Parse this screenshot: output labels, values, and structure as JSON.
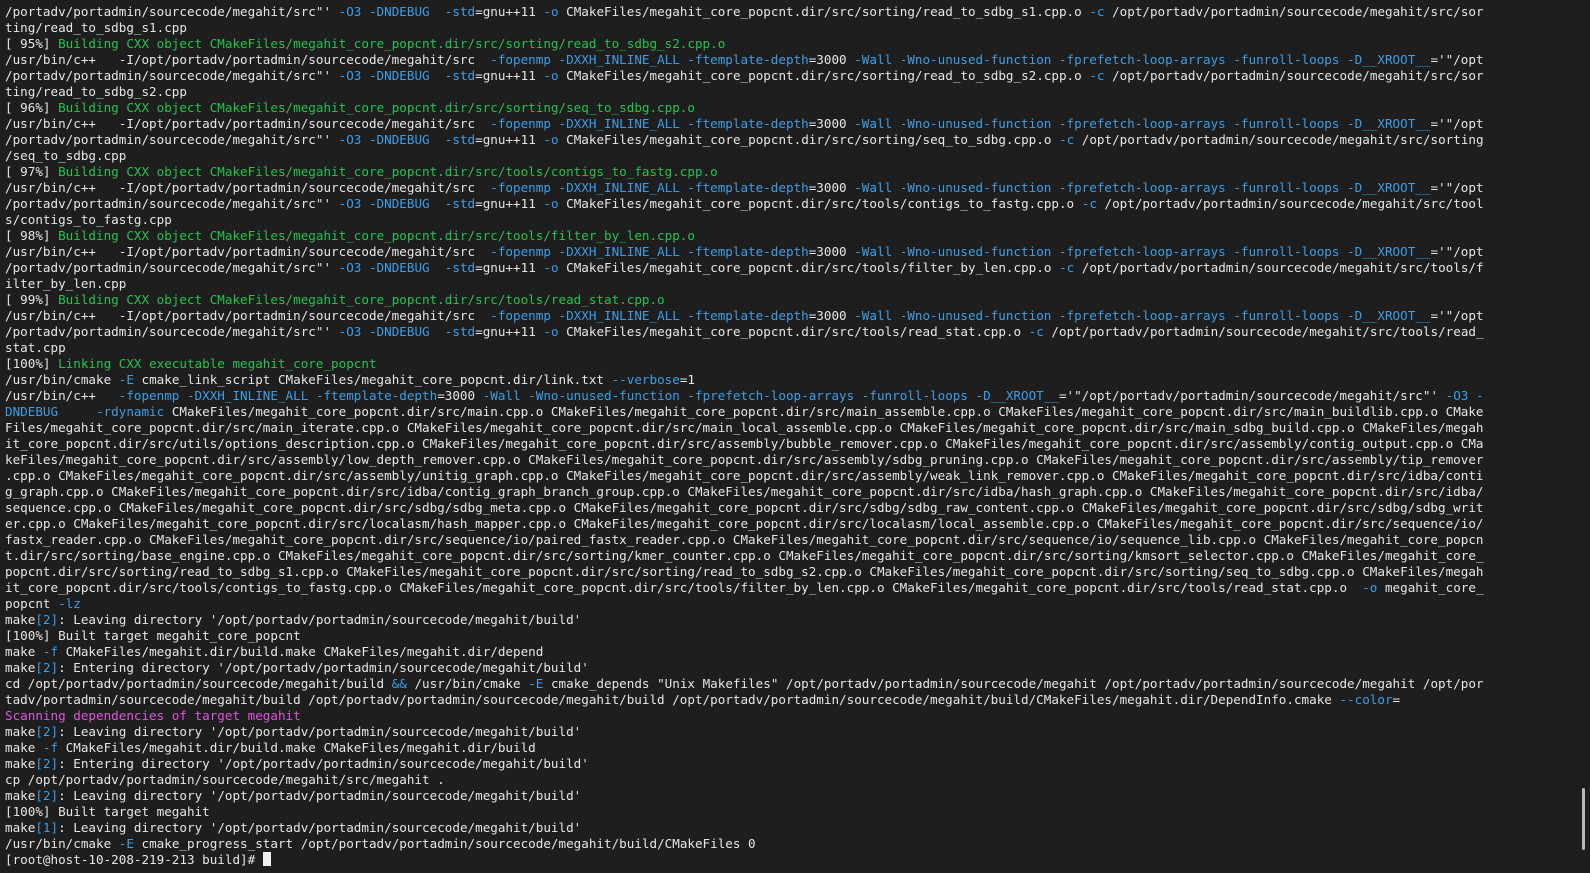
{
  "colors": {
    "background": "#1e1e1e",
    "text": "#e6e6e6",
    "flag": "#3a9ee8",
    "progress_green": "#21c44f",
    "magenta": "#e052e0"
  },
  "terminal": {
    "lines": [
      [
        [
          "/portadv/portadmin/sourcecode/megahit/src\"' ",
          "t"
        ],
        [
          "-O3 -DNDEBUG",
          "f"
        ],
        [
          "  ",
          "t"
        ],
        [
          "-std",
          "f"
        ],
        [
          "=gnu++11 ",
          "t"
        ],
        [
          "-o",
          "f"
        ],
        [
          " CMakeFiles/megahit_core_popcnt.dir/src/sorting/read_to_sdbg_s1.cpp.o ",
          "t"
        ],
        [
          "-c",
          "f"
        ],
        [
          " /opt/portadv/portadmin/sourcecode/megahit/src/sor",
          "t"
        ]
      ],
      [
        [
          "ting/read_to_sdbg_s1.cpp",
          "t"
        ]
      ],
      [
        [
          "[ 95%] ",
          "t"
        ],
        [
          "Building CXX object CMakeFiles/megahit_core_popcnt.dir/src/sorting/read_to_sdbg_s2.cpp.o",
          "g"
        ]
      ],
      [
        [
          "/usr/bin/c++   -I/opt/portadv/portadmin/sourcecode/megahit/src  ",
          "t"
        ],
        [
          "-fopenmp -DXXH_INLINE_ALL -ftemplate-depth",
          "f"
        ],
        [
          "=3000 ",
          "t"
        ],
        [
          "-Wall -Wno-unused-function -fprefetch-loop-arrays -funroll-loops -D__XROOT__",
          "f"
        ],
        [
          "='\"/opt",
          "t"
        ]
      ],
      [
        [
          "/portadv/portadmin/sourcecode/megahit/src\"' ",
          "t"
        ],
        [
          "-O3 -DNDEBUG",
          "f"
        ],
        [
          "  ",
          "t"
        ],
        [
          "-std",
          "f"
        ],
        [
          "=gnu++11 ",
          "t"
        ],
        [
          "-o",
          "f"
        ],
        [
          " CMakeFiles/megahit_core_popcnt.dir/src/sorting/read_to_sdbg_s2.cpp.o ",
          "t"
        ],
        [
          "-c",
          "f"
        ],
        [
          " /opt/portadv/portadmin/sourcecode/megahit/src/sor",
          "t"
        ]
      ],
      [
        [
          "ting/read_to_sdbg_s2.cpp",
          "t"
        ]
      ],
      [
        [
          "[ 96%] ",
          "t"
        ],
        [
          "Building CXX object CMakeFiles/megahit_core_popcnt.dir/src/sorting/seq_to_sdbg.cpp.o",
          "g"
        ]
      ],
      [
        [
          "/usr/bin/c++   -I/opt/portadv/portadmin/sourcecode/megahit/src  ",
          "t"
        ],
        [
          "-fopenmp -DXXH_INLINE_ALL -ftemplate-depth",
          "f"
        ],
        [
          "=3000 ",
          "t"
        ],
        [
          "-Wall -Wno-unused-function -fprefetch-loop-arrays -funroll-loops -D__XROOT__",
          "f"
        ],
        [
          "='\"/opt",
          "t"
        ]
      ],
      [
        [
          "/portadv/portadmin/sourcecode/megahit/src\"' ",
          "t"
        ],
        [
          "-O3 -DNDEBUG",
          "f"
        ],
        [
          "  ",
          "t"
        ],
        [
          "-std",
          "f"
        ],
        [
          "=gnu++11 ",
          "t"
        ],
        [
          "-o",
          "f"
        ],
        [
          " CMakeFiles/megahit_core_popcnt.dir/src/sorting/seq_to_sdbg.cpp.o ",
          "t"
        ],
        [
          "-c",
          "f"
        ],
        [
          " /opt/portadv/portadmin/sourcecode/megahit/src/sorting",
          "t"
        ]
      ],
      [
        [
          "/seq_to_sdbg.cpp",
          "t"
        ]
      ],
      [
        [
          "[ 97%] ",
          "t"
        ],
        [
          "Building CXX object CMakeFiles/megahit_core_popcnt.dir/src/tools/contigs_to_fastg.cpp.o",
          "g"
        ]
      ],
      [
        [
          "/usr/bin/c++   -I/opt/portadv/portadmin/sourcecode/megahit/src  ",
          "t"
        ],
        [
          "-fopenmp -DXXH_INLINE_ALL -ftemplate-depth",
          "f"
        ],
        [
          "=3000 ",
          "t"
        ],
        [
          "-Wall -Wno-unused-function -fprefetch-loop-arrays -funroll-loops -D__XROOT__",
          "f"
        ],
        [
          "='\"/opt",
          "t"
        ]
      ],
      [
        [
          "/portadv/portadmin/sourcecode/megahit/src\"' ",
          "t"
        ],
        [
          "-O3 -DNDEBUG",
          "f"
        ],
        [
          "  ",
          "t"
        ],
        [
          "-std",
          "f"
        ],
        [
          "=gnu++11 ",
          "t"
        ],
        [
          "-o",
          "f"
        ],
        [
          " CMakeFiles/megahit_core_popcnt.dir/src/tools/contigs_to_fastg.cpp.o ",
          "t"
        ],
        [
          "-c",
          "f"
        ],
        [
          " /opt/portadv/portadmin/sourcecode/megahit/src/tool",
          "t"
        ]
      ],
      [
        [
          "s/contigs_to_fastg.cpp",
          "t"
        ]
      ],
      [
        [
          "[ 98%] ",
          "t"
        ],
        [
          "Building CXX object CMakeFiles/megahit_core_popcnt.dir/src/tools/filter_by_len.cpp.o",
          "g"
        ]
      ],
      [
        [
          "/usr/bin/c++   -I/opt/portadv/portadmin/sourcecode/megahit/src  ",
          "t"
        ],
        [
          "-fopenmp -DXXH_INLINE_ALL -ftemplate-depth",
          "f"
        ],
        [
          "=3000 ",
          "t"
        ],
        [
          "-Wall -Wno-unused-function -fprefetch-loop-arrays -funroll-loops -D__XROOT__",
          "f"
        ],
        [
          "='\"/opt",
          "t"
        ]
      ],
      [
        [
          "/portadv/portadmin/sourcecode/megahit/src\"' ",
          "t"
        ],
        [
          "-O3 -DNDEBUG",
          "f"
        ],
        [
          "  ",
          "t"
        ],
        [
          "-std",
          "f"
        ],
        [
          "=gnu++11 ",
          "t"
        ],
        [
          "-o",
          "f"
        ],
        [
          " CMakeFiles/megahit_core_popcnt.dir/src/tools/filter_by_len.cpp.o ",
          "t"
        ],
        [
          "-c",
          "f"
        ],
        [
          " /opt/portadv/portadmin/sourcecode/megahit/src/tools/f",
          "t"
        ]
      ],
      [
        [
          "ilter_by_len.cpp",
          "t"
        ]
      ],
      [
        [
          "[ 99%] ",
          "t"
        ],
        [
          "Building CXX object CMakeFiles/megahit_core_popcnt.dir/src/tools/read_stat.cpp.o",
          "g"
        ]
      ],
      [
        [
          "/usr/bin/c++   -I/opt/portadv/portadmin/sourcecode/megahit/src  ",
          "t"
        ],
        [
          "-fopenmp -DXXH_INLINE_ALL -ftemplate-depth",
          "f"
        ],
        [
          "=3000 ",
          "t"
        ],
        [
          "-Wall -Wno-unused-function -fprefetch-loop-arrays -funroll-loops -D__XROOT__",
          "f"
        ],
        [
          "='\"/opt",
          "t"
        ]
      ],
      [
        [
          "/portadv/portadmin/sourcecode/megahit/src\"' ",
          "t"
        ],
        [
          "-O3 -DNDEBUG",
          "f"
        ],
        [
          "  ",
          "t"
        ],
        [
          "-std",
          "f"
        ],
        [
          "=gnu++11 ",
          "t"
        ],
        [
          "-o",
          "f"
        ],
        [
          " CMakeFiles/megahit_core_popcnt.dir/src/tools/read_stat.cpp.o ",
          "t"
        ],
        [
          "-c",
          "f"
        ],
        [
          " /opt/portadv/portadmin/sourcecode/megahit/src/tools/read_",
          "t"
        ]
      ],
      [
        [
          "stat.cpp",
          "t"
        ]
      ],
      [
        [
          "[100%] ",
          "t"
        ],
        [
          "Linking CXX executable megahit_core_popcnt",
          "g"
        ]
      ],
      [
        [
          "/usr/bin/cmake ",
          "t"
        ],
        [
          "-E",
          "f"
        ],
        [
          " cmake_link_script CMakeFiles/megahit_core_popcnt.dir/link.txt ",
          "t"
        ],
        [
          "--verbose",
          "f"
        ],
        [
          "=1",
          "t"
        ]
      ],
      [
        [
          "/usr/bin/c++   ",
          "t"
        ],
        [
          "-fopenmp -DXXH_INLINE_ALL -ftemplate-depth",
          "f"
        ],
        [
          "=3000 ",
          "t"
        ],
        [
          "-Wall -Wno-unused-function -fprefetch-loop-arrays -funroll-loops -D__XROOT__",
          "f"
        ],
        [
          "='\"/opt/portadv/portadmin/sourcecode/megahit/src\"' ",
          "t"
        ],
        [
          "-O3 -",
          "f"
        ]
      ],
      [
        [
          "DNDEBUG     -rdynamic",
          "f"
        ],
        [
          " CMakeFiles/megahit_core_popcnt.dir/src/main.cpp.o CMakeFiles/megahit_core_popcnt.dir/src/main_assemble.cpp.o CMakeFiles/megahit_core_popcnt.dir/src/main_buildlib.cpp.o CMake",
          "t"
        ]
      ],
      [
        [
          "Files/megahit_core_popcnt.dir/src/main_iterate.cpp.o CMakeFiles/megahit_core_popcnt.dir/src/main_local_assemble.cpp.o CMakeFiles/megahit_core_popcnt.dir/src/main_sdbg_build.cpp.o CMakeFiles/megah",
          "t"
        ]
      ],
      [
        [
          "it_core_popcnt.dir/src/utils/options_description.cpp.o CMakeFiles/megahit_core_popcnt.dir/src/assembly/bubble_remover.cpp.o CMakeFiles/megahit_core_popcnt.dir/src/assembly/contig_output.cpp.o CMa",
          "t"
        ]
      ],
      [
        [
          "keFiles/megahit_core_popcnt.dir/src/assembly/low_depth_remover.cpp.o CMakeFiles/megahit_core_popcnt.dir/src/assembly/sdbg_pruning.cpp.o CMakeFiles/megahit_core_popcnt.dir/src/assembly/tip_remover",
          "t"
        ]
      ],
      [
        [
          ".cpp.o CMakeFiles/megahit_core_popcnt.dir/src/assembly/unitig_graph.cpp.o CMakeFiles/megahit_core_popcnt.dir/src/assembly/weak_link_remover.cpp.o CMakeFiles/megahit_core_popcnt.dir/src/idba/conti",
          "t"
        ]
      ],
      [
        [
          "g_graph.cpp.o CMakeFiles/megahit_core_popcnt.dir/src/idba/contig_graph_branch_group.cpp.o CMakeFiles/megahit_core_popcnt.dir/src/idba/hash_graph.cpp.o CMakeFiles/megahit_core_popcnt.dir/src/idba/",
          "t"
        ]
      ],
      [
        [
          "sequence.cpp.o CMakeFiles/megahit_core_popcnt.dir/src/sdbg/sdbg_meta.cpp.o CMakeFiles/megahit_core_popcnt.dir/src/sdbg/sdbg_raw_content.cpp.o CMakeFiles/megahit_core_popcnt.dir/src/sdbg/sdbg_writ",
          "t"
        ]
      ],
      [
        [
          "er.cpp.o CMakeFiles/megahit_core_popcnt.dir/src/localasm/hash_mapper.cpp.o CMakeFiles/megahit_core_popcnt.dir/src/localasm/local_assemble.cpp.o CMakeFiles/megahit_core_popcnt.dir/src/sequence/io/",
          "t"
        ]
      ],
      [
        [
          "fastx_reader.cpp.o CMakeFiles/megahit_core_popcnt.dir/src/sequence/io/paired_fastx_reader.cpp.o CMakeFiles/megahit_core_popcnt.dir/src/sequence/io/sequence_lib.cpp.o CMakeFiles/megahit_core_popcn",
          "t"
        ]
      ],
      [
        [
          "t.dir/src/sorting/base_engine.cpp.o CMakeFiles/megahit_core_popcnt.dir/src/sorting/kmer_counter.cpp.o CMakeFiles/megahit_core_popcnt.dir/src/sorting/kmsort_selector.cpp.o CMakeFiles/megahit_core_",
          "t"
        ]
      ],
      [
        [
          "popcnt.dir/src/sorting/read_to_sdbg_s1.cpp.o CMakeFiles/megahit_core_popcnt.dir/src/sorting/read_to_sdbg_s2.cpp.o CMakeFiles/megahit_core_popcnt.dir/src/sorting/seq_to_sdbg.cpp.o CMakeFiles/megah",
          "t"
        ]
      ],
      [
        [
          "it_core_popcnt.dir/src/tools/contigs_to_fastg.cpp.o CMakeFiles/megahit_core_popcnt.dir/src/tools/filter_by_len.cpp.o CMakeFiles/megahit_core_popcnt.dir/src/tools/read_stat.cpp.o  ",
          "t"
        ],
        [
          "-o",
          "f"
        ],
        [
          " megahit_core_",
          "t"
        ]
      ],
      [
        [
          "popcnt ",
          "t"
        ],
        [
          "-lz",
          "f"
        ]
      ],
      [
        [
          "make",
          "t"
        ],
        [
          "[2]",
          "f"
        ],
        [
          ": Leaving directory '/opt/portadv/portadmin/sourcecode/megahit/build'",
          "t"
        ]
      ],
      [
        [
          "[100%] Built target megahit_core_popcnt",
          "t"
        ]
      ],
      [
        [
          "make ",
          "t"
        ],
        [
          "-f",
          "f"
        ],
        [
          " CMakeFiles/megahit.dir/build.make CMakeFiles/megahit.dir/depend",
          "t"
        ]
      ],
      [
        [
          "make",
          "t"
        ],
        [
          "[2]",
          "f"
        ],
        [
          ": Entering directory '/opt/portadv/portadmin/sourcecode/megahit/build'",
          "t"
        ]
      ],
      [
        [
          "cd /opt/portadv/portadmin/sourcecode/megahit/build ",
          "t"
        ],
        [
          "&&",
          "f"
        ],
        [
          " /usr/bin/cmake ",
          "t"
        ],
        [
          "-E",
          "f"
        ],
        [
          " cmake_depends \"Unix Makefiles\" /opt/portadv/portadmin/sourcecode/megahit /opt/portadv/portadmin/sourcecode/megahit /opt/por",
          "t"
        ]
      ],
      [
        [
          "tadv/portadmin/sourcecode/megahit/build /opt/portadv/portadmin/sourcecode/megahit/build /opt/portadv/portadmin/sourcecode/megahit/build/CMakeFiles/megahit.dir/DependInfo.cmake ",
          "t"
        ],
        [
          "--color",
          "f"
        ],
        [
          "=",
          "t"
        ]
      ],
      [
        [
          "Scanning dependencies of target megahit",
          "m"
        ]
      ],
      [
        [
          "make",
          "t"
        ],
        [
          "[2]",
          "f"
        ],
        [
          ": Leaving directory '/opt/portadv/portadmin/sourcecode/megahit/build'",
          "t"
        ]
      ],
      [
        [
          "make ",
          "t"
        ],
        [
          "-f",
          "f"
        ],
        [
          " CMakeFiles/megahit.dir/build.make CMakeFiles/megahit.dir/build",
          "t"
        ]
      ],
      [
        [
          "make",
          "t"
        ],
        [
          "[2]",
          "f"
        ],
        [
          ": Entering directory '/opt/portadv/portadmin/sourcecode/megahit/build'",
          "t"
        ]
      ],
      [
        [
          "cp /opt/portadv/portadmin/sourcecode/megahit/src/megahit .",
          "t"
        ]
      ],
      [
        [
          "make",
          "t"
        ],
        [
          "[2]",
          "f"
        ],
        [
          ": Leaving directory '/opt/portadv/portadmin/sourcecode/megahit/build'",
          "t"
        ]
      ],
      [
        [
          "[100%] Built target megahit",
          "t"
        ]
      ],
      [
        [
          "make",
          "t"
        ],
        [
          "[1]",
          "f"
        ],
        [
          ": Leaving directory '/opt/portadv/portadmin/sourcecode/megahit/build'",
          "t"
        ]
      ],
      [
        [
          "/usr/bin/cmake ",
          "t"
        ],
        [
          "-E",
          "f"
        ],
        [
          " cmake_progress_start /opt/portadv/portadmin/sourcecode/megahit/build/CMakeFiles 0",
          "t"
        ]
      ]
    ],
    "prompt": "[root@host-10-208-219-213 build]# "
  }
}
